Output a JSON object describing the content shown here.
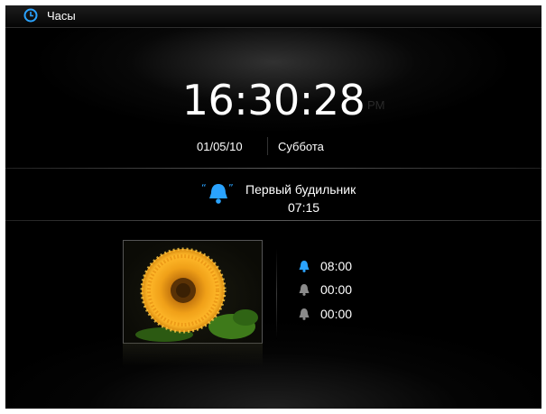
{
  "window": {
    "title": "Часы",
    "icon": "clock-icon",
    "accent": "#2aa3ff"
  },
  "clock": {
    "time": "16:30:28",
    "ampm": "PM",
    "date": "01/05/10",
    "weekday": "Суббота"
  },
  "next_alarm": {
    "icon": "ringing-bell-icon",
    "name": "Первый будильник",
    "time": "07:15"
  },
  "photo": {
    "subject": "sunflower-photo"
  },
  "alarms": [
    {
      "time": "08:00",
      "enabled": true,
      "icon": "bell-icon"
    },
    {
      "time": "00:00",
      "enabled": false,
      "icon": "bell-icon"
    },
    {
      "time": "00:00",
      "enabled": false,
      "icon": "bell-icon"
    }
  ]
}
